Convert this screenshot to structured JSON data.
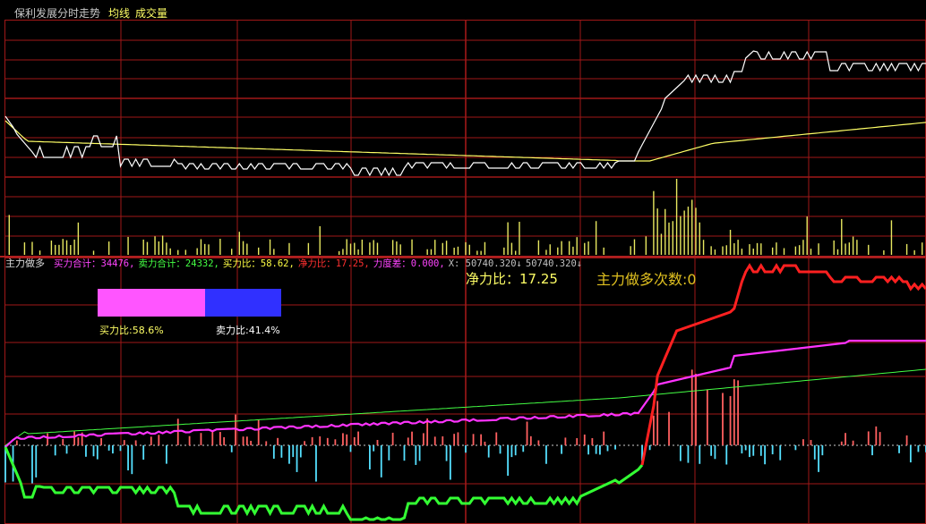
{
  "window": {
    "title": "保利发展分时走势",
    "legend_ma": "均线",
    "legend_vol": "成交量"
  },
  "indicator": {
    "name": "主力做多",
    "items": [
      {
        "label": "买力合计",
        "value": "34476",
        "color": "#ff44ff"
      },
      {
        "label": "卖力合计",
        "value": "24332",
        "color": "#44ff44"
      },
      {
        "label": "买力比",
        "value": "58.62",
        "color": "#ffff44"
      },
      {
        "label": "净力比",
        "value": "17.25",
        "color": "#ff3030"
      },
      {
        "label": "力度差",
        "value": "0.000",
        "color": "#ff44ff"
      },
      {
        "label": "X",
        "value": "50740.320",
        "color": "#c0c0c0"
      },
      {
        "label": "",
        "value": "50740.320",
        "color": "#c0c0c0"
      }
    ],
    "net_ratio_label": "净力比：17.25",
    "long_count_label": "主力做多次数:0",
    "buy_bar_label": "买力比:58.6%",
    "sell_bar_label": "卖力比:41.4%",
    "buy_ratio": 0.586,
    "sell_ratio": 0.414
  },
  "chart_data": [
    {
      "type": "line",
      "title": "保利发展分时走势",
      "series": [
        {
          "name": "",
          "color": "#ffffff",
          "role": "price",
          "values": []
        },
        {
          "name": "均线",
          "color": "#ffff66",
          "role": "average",
          "values": []
        }
      ],
      "volume": {
        "name": "成交量",
        "color": "#ffff66",
        "values": []
      }
    },
    {
      "type": "line",
      "title": "主力做多",
      "series": [
        {
          "name": "",
          "color": "#ff2020",
          "role": "net",
          "values": []
        },
        {
          "name": "",
          "color": "#ff33ff",
          "role": "buy",
          "values": []
        },
        {
          "name": "",
          "color": "#44ff44",
          "role": "sell-thin",
          "values": []
        },
        {
          "name": "",
          "color": "#33ff33",
          "role": "sell",
          "values": []
        }
      ],
      "bars": {
        "up_color": "#ff6060",
        "down_color": "#55e0ff",
        "values": []
      }
    }
  ]
}
